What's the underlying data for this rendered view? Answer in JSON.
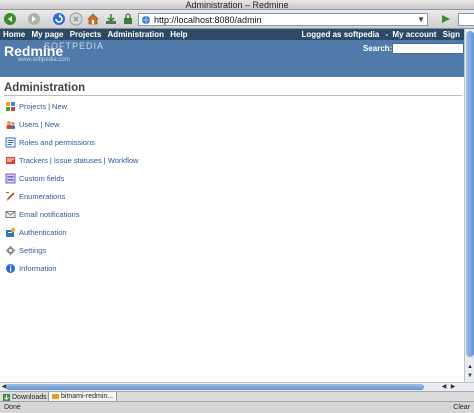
{
  "window": {
    "title": "Administration – Redmine"
  },
  "browser": {
    "url": "http://localhost:8080/admin",
    "icons": [
      "back-icon",
      "forward-icon",
      "reload-icon",
      "stop-icon",
      "home-icon",
      "download-icon",
      "lock-icon",
      "go-icon"
    ]
  },
  "topmenu": {
    "items": [
      "Home",
      "My page",
      "Projects",
      "Administration",
      "Help"
    ],
    "logged_as": "Logged as softpedia",
    "my_account": "My account",
    "sign_out": "Sign"
  },
  "header": {
    "title": "Redmine",
    "watermark": "SOFTPEDIA",
    "watermark_url": "www.softpedia.com",
    "search_label": "Search:",
    "search_value": ""
  },
  "page": {
    "title": "Administration",
    "items": [
      {
        "links": [
          "Projects",
          "New"
        ],
        "icon": "projects-icon"
      },
      {
        "links": [
          "Users",
          "New"
        ],
        "icon": "users-icon"
      },
      {
        "links": [
          "Roles and permissions"
        ],
        "icon": "roles-icon"
      },
      {
        "links": [
          "Trackers",
          "Issue statuses",
          "Workflow"
        ],
        "icon": "trackers-icon"
      },
      {
        "links": [
          "Custom fields"
        ],
        "icon": "custom-fields-icon"
      },
      {
        "links": [
          "Enumerations"
        ],
        "icon": "enumerations-icon"
      },
      {
        "links": [
          "Email notifications"
        ],
        "icon": "email-icon"
      },
      {
        "links": [
          "Authentication"
        ],
        "icon": "authentication-icon"
      },
      {
        "links": [
          "Settings"
        ],
        "icon": "settings-icon"
      },
      {
        "links": [
          "Information"
        ],
        "icon": "information-icon"
      }
    ]
  },
  "tabs": {
    "downloads": "Downloads",
    "active_tab": "bitnami-redmin..."
  },
  "status": {
    "done": "Done",
    "clear": "Clear"
  },
  "colors": {
    "topmenu_bg": "#2c4a68",
    "header_bg": "#507aaa",
    "link": "#2a5a9a"
  }
}
